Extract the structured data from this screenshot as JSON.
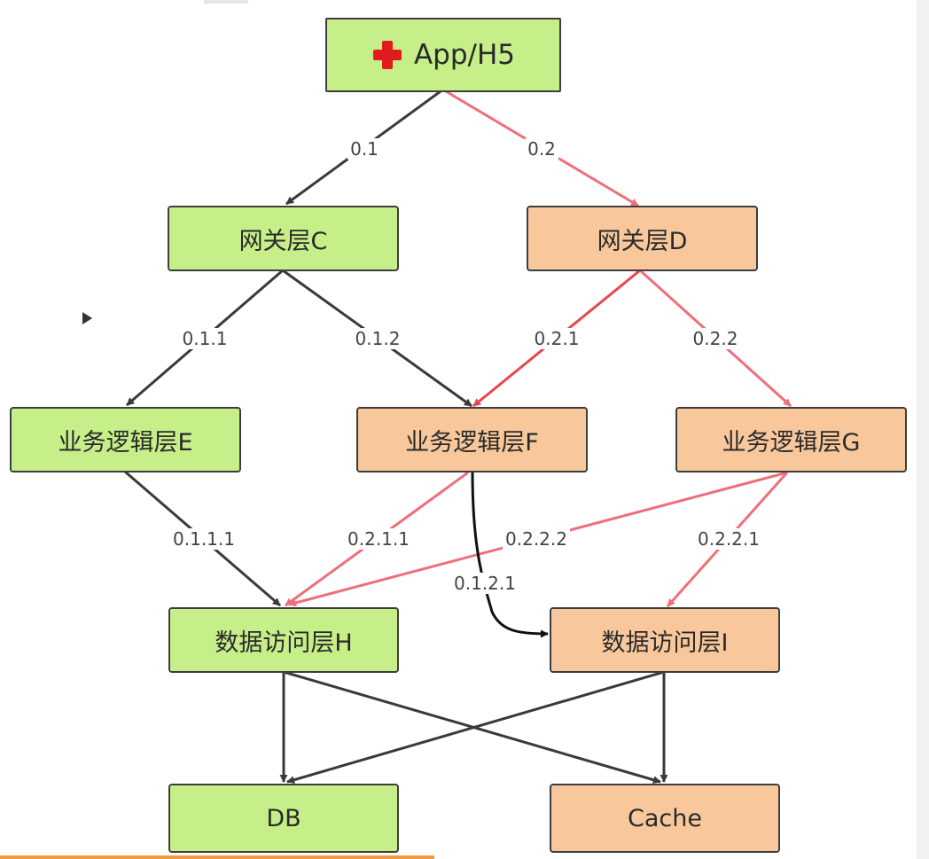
{
  "nodes": {
    "app": "App/H5",
    "gateway_c": "网关层C",
    "gateway_d": "网关层D",
    "biz_e": "业务逻辑层E",
    "biz_f": "业务逻辑层F",
    "biz_g": "业务逻辑层G",
    "data_h": "数据访问层H",
    "data_i": "数据访问层I",
    "db": "DB",
    "cache": "Cache"
  },
  "edges": {
    "e_0_1": "0.1",
    "e_0_2": "0.2",
    "e_0_1_1": "0.1.1",
    "e_0_1_2": "0.1.2",
    "e_0_2_1": "0.2.1",
    "e_0_2_2": "0.2.2",
    "e_0_1_1_1": "0.1.1.1",
    "e_0_2_1_1": "0.2.1.1",
    "e_0_2_2_2": "0.2.2.2",
    "e_0_1_2_1": "0.1.2.1",
    "e_0_2_2_1": "0.2.2.1"
  },
  "colors": {
    "green_fill": "#c6ef8a",
    "orange_fill": "#f8c89c",
    "dark_edge": "#3a3a3a",
    "red_edge": "#ee6f7a",
    "red_edge_strong": "#e8454f",
    "icon_red": "#e11b1b"
  },
  "icons": {
    "app": "red-cross-icon",
    "player": "play-triangle-icon"
  }
}
